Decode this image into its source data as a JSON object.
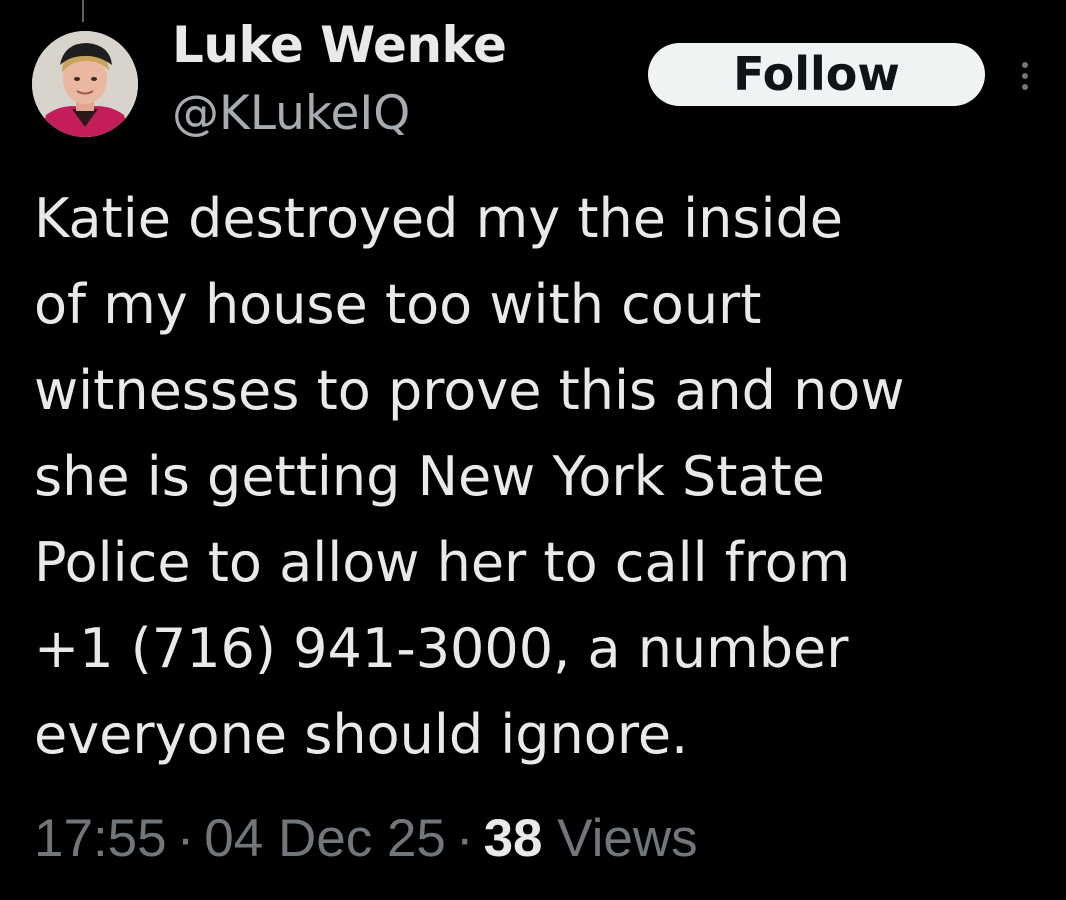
{
  "tweet": {
    "author": {
      "display_name": "Luke Wenke",
      "handle": "@KLukeIQ",
      "avatar_icon": "profile-photo"
    },
    "follow_label": "Follow",
    "more_icon": "vertical-ellipsis-icon",
    "text_lines": [
      "Katie destroyed my the inside",
      "of my house too with court",
      "witnesses to prove this and now",
      "she is getting New York State",
      "Police to allow her to call from",
      "+1 (716) 941-3000, a number",
      "everyone should ignore."
    ],
    "meta": {
      "time": "17:55",
      "separator": "·",
      "date": "04 Dec 25",
      "views_count": "38",
      "views_label": "Views"
    }
  },
  "colors": {
    "background": "#000000",
    "primary_text": "#e7e9ea",
    "secondary_text": "#71767b",
    "follow_button_bg": "#eff3f4",
    "follow_button_text": "#0f1419"
  }
}
